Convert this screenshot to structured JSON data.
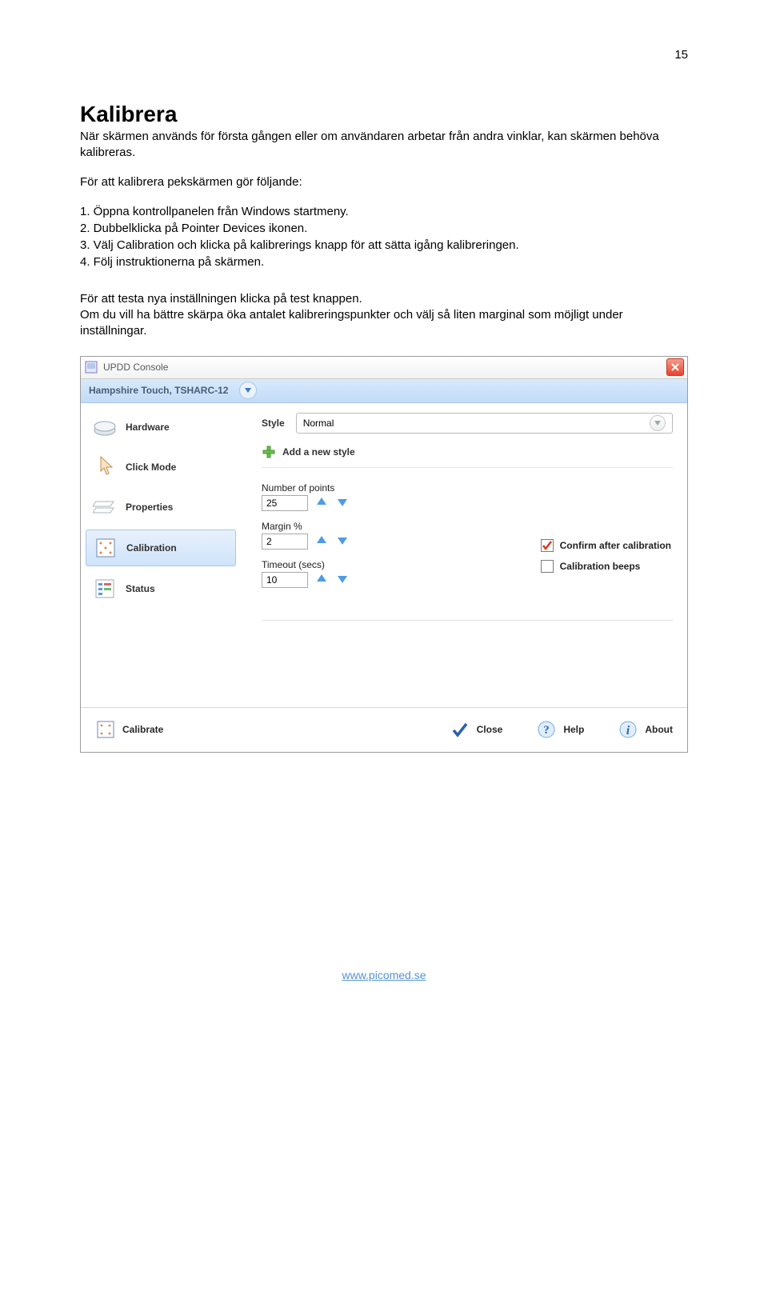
{
  "page_number": "15",
  "heading": "Kalibrera",
  "intro": "När skärmen används för första gången eller om användaren arbetar från andra vinklar, kan skärmen behöva kalibreras.",
  "sub_intro": "För att kalibrera pekskärmen gör följande:",
  "steps": {
    "s1": "1. Öppna kontrollpanelen från Windows startmeny.",
    "s2": "2. Dubbelklicka på Pointer Devices ikonen.",
    "s3": "3. Välj Calibration och klicka på kalibrerings knapp för att sätta igång kalibreringen.",
    "s4": "4. Följ instruktionerna på skärmen."
  },
  "note1": "För att testa nya inställningen klicka på test knappen.",
  "note2": "Om du vill ha bättre skärpa öka antalet kalibreringspunkter och välj så liten marginal som möjligt under inställningar.",
  "window": {
    "title": "UPDD Console",
    "device": "Hampshire Touch, TSHARC-12",
    "sidebar": {
      "items": [
        {
          "label": "Hardware"
        },
        {
          "label": "Click Mode"
        },
        {
          "label": "Properties"
        },
        {
          "label": "Calibration"
        },
        {
          "label": "Status"
        }
      ]
    },
    "style": {
      "label": "Style",
      "value": "Normal"
    },
    "add_style": "Add a new style",
    "fields": {
      "points": {
        "label": "Number of points",
        "value": "25"
      },
      "margin": {
        "label": "Margin %",
        "value": "2"
      },
      "timeout": {
        "label": "Timeout (secs)",
        "value": "10"
      }
    },
    "checks": {
      "confirm": "Confirm after calibration",
      "beeps": "Calibration beeps"
    },
    "bottom": {
      "calibrate": "Calibrate",
      "close": "Close",
      "help": "Help",
      "about": "About"
    }
  },
  "footer": "www.picomed.se"
}
